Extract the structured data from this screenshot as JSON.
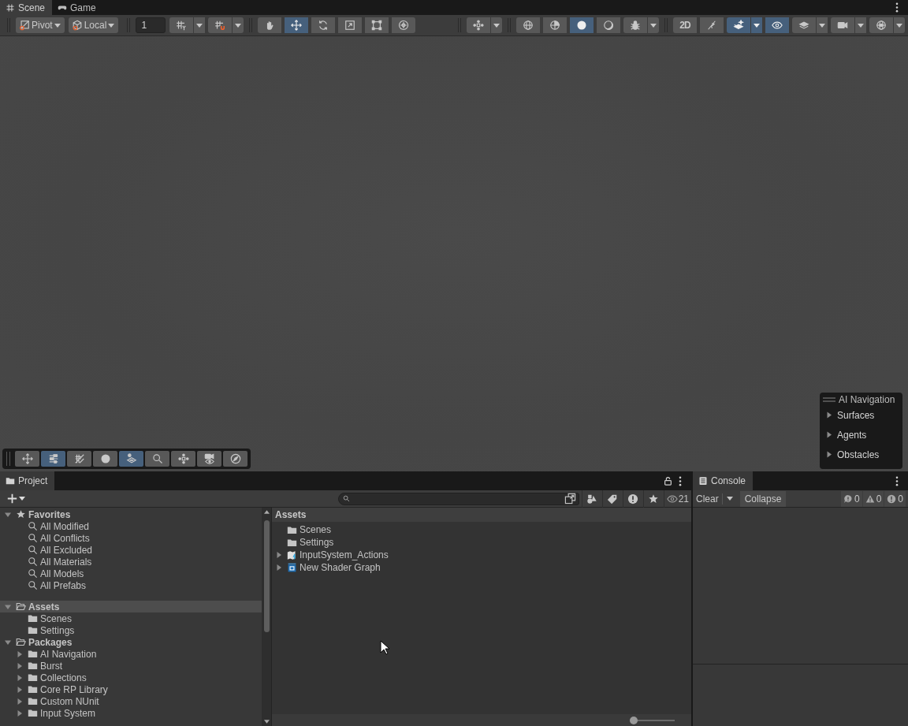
{
  "scene_tabs": [
    {
      "kind": "grid",
      "label": "Scene",
      "selected": true
    },
    {
      "kind": "gamepad",
      "label": "Game",
      "selected": false
    }
  ],
  "scene_toolbar": {
    "left": [
      [
        {
          "kind": "pivot",
          "label": "Pivot",
          "dropdown": true
        },
        {
          "kind": "local",
          "label": "Local",
          "dropdown": true
        }
      ],
      [
        {
          "kind": "field",
          "value": "1"
        },
        {
          "kind": "gridsnap",
          "dropdown": true
        },
        {
          "kind": "magnet",
          "dropdown": true
        }
      ],
      [
        {
          "kind": "hand",
          "selected": false
        },
        {
          "kind": "move",
          "selected": true
        },
        {
          "kind": "rotate",
          "selected": false
        },
        {
          "kind": "scale",
          "selected": false
        },
        {
          "kind": "rect",
          "selected": false
        },
        {
          "kind": "transform",
          "selected": false
        }
      ]
    ],
    "right": [
      [
        {
          "kind": "orientation",
          "dropdown": true
        }
      ],
      [
        {
          "kind": "wire",
          "selected": false
        },
        {
          "kind": "shaded",
          "selected": false
        },
        {
          "kind": "sphere",
          "selected": true
        },
        {
          "kind": "moon",
          "selected": false
        },
        {
          "kind": "bug",
          "dropdown": true,
          "selected": false
        }
      ],
      [
        {
          "kind": "twod",
          "label": "2D",
          "selected": false
        },
        {
          "kind": "lightoff",
          "selected": false
        },
        {
          "kind": "effects",
          "dropdown": true,
          "selected": true
        },
        {
          "kind": "eye",
          "selected": true
        },
        {
          "kind": "layers",
          "dropdown": true,
          "selected": false
        },
        {
          "kind": "camera",
          "dropdown": true,
          "selected": false
        },
        {
          "kind": "gizmos",
          "dropdown": true,
          "selected": false
        }
      ]
    ]
  },
  "overlay_toolbar": [
    {
      "kind": "move",
      "selected": false
    },
    {
      "kind": "sliders",
      "selected": true
    },
    {
      "kind": "hatch",
      "selected": false
    },
    {
      "kind": "sphere",
      "selected": false
    },
    {
      "kind": "navmesh",
      "selected": true
    },
    {
      "kind": "search",
      "selected": false
    },
    {
      "kind": "orientation",
      "selected": false
    },
    {
      "kind": "cameraeye",
      "selected": false
    },
    {
      "kind": "compass",
      "selected": false
    }
  ],
  "ai_navigation": {
    "title": "AI Navigation",
    "items": [
      {
        "label": "Surfaces",
        "expanded": false
      },
      {
        "label": "Agents",
        "expanded": false
      },
      {
        "label": "Obstacles",
        "expanded": false
      }
    ]
  },
  "project": {
    "tabs": [
      {
        "kind": "folder",
        "label": "Project",
        "selected": true
      }
    ],
    "filters": [
      {
        "kind": "shapes"
      },
      {
        "kind": "tag"
      },
      {
        "kind": "alert"
      },
      {
        "kind": "star"
      },
      {
        "kind": "eye",
        "label": "21"
      }
    ],
    "tree": [
      {
        "label": "Favorites",
        "kind": "star",
        "expanded": true,
        "selected": false,
        "children": [
          {
            "label": "All Modified",
            "kind": "search",
            "selected": false
          },
          {
            "label": "All Conflicts",
            "kind": "search",
            "selected": false
          },
          {
            "label": "All Excluded",
            "kind": "search",
            "selected": false
          },
          {
            "label": "All Materials",
            "kind": "search",
            "selected": false
          },
          {
            "label": "All Models",
            "kind": "search",
            "selected": false
          },
          {
            "label": "All Prefabs",
            "kind": "search",
            "selected": false
          }
        ]
      },
      {
        "label": "Assets",
        "kind": "folder",
        "expanded": true,
        "selected": true,
        "children": [
          {
            "label": "Scenes",
            "kind": "folder",
            "selected": false
          },
          {
            "label": "Settings",
            "kind": "folder",
            "selected": false
          }
        ]
      },
      {
        "label": "Packages",
        "kind": "folder",
        "expanded": true,
        "selected": false,
        "children": [
          {
            "label": "AI Navigation",
            "kind": "folder",
            "expanded": false,
            "selected": false
          },
          {
            "label": "Burst",
            "kind": "folder",
            "expanded": false,
            "selected": false
          },
          {
            "label": "Collections",
            "kind": "folder",
            "expanded": false,
            "selected": false
          },
          {
            "label": "Core RP Library",
            "kind": "folder",
            "expanded": false,
            "selected": false
          },
          {
            "label": "Custom NUnit",
            "kind": "folder",
            "expanded": false,
            "selected": false
          },
          {
            "label": "Input System",
            "kind": "folder",
            "expanded": false,
            "selected": false
          }
        ]
      }
    ],
    "assets_view": {
      "title": "Assets",
      "items": [
        {
          "label": "Scenes",
          "kind": "folder",
          "selected": false
        },
        {
          "label": "Settings",
          "kind": "folder",
          "selected": false
        },
        {
          "label": "InputSystem_Actions",
          "kind": "inputactions",
          "expanded": false,
          "selected": false
        },
        {
          "label": "New Shader Graph",
          "kind": "shadergraph",
          "expanded": false,
          "selected": false
        }
      ],
      "zoom": {
        "level": 0
      }
    }
  },
  "console": {
    "tabs": [
      {
        "kind": "console",
        "label": "Console",
        "selected": true
      }
    ],
    "buttons": [
      {
        "kind": "action",
        "label": "Clear",
        "dropdown": true
      },
      {
        "kind": "toggle",
        "label": "Collapse"
      }
    ],
    "counts": [
      {
        "kind": "info",
        "count": "0"
      },
      {
        "kind": "warning",
        "count": "0"
      },
      {
        "kind": "error",
        "count": "0"
      }
    ]
  }
}
